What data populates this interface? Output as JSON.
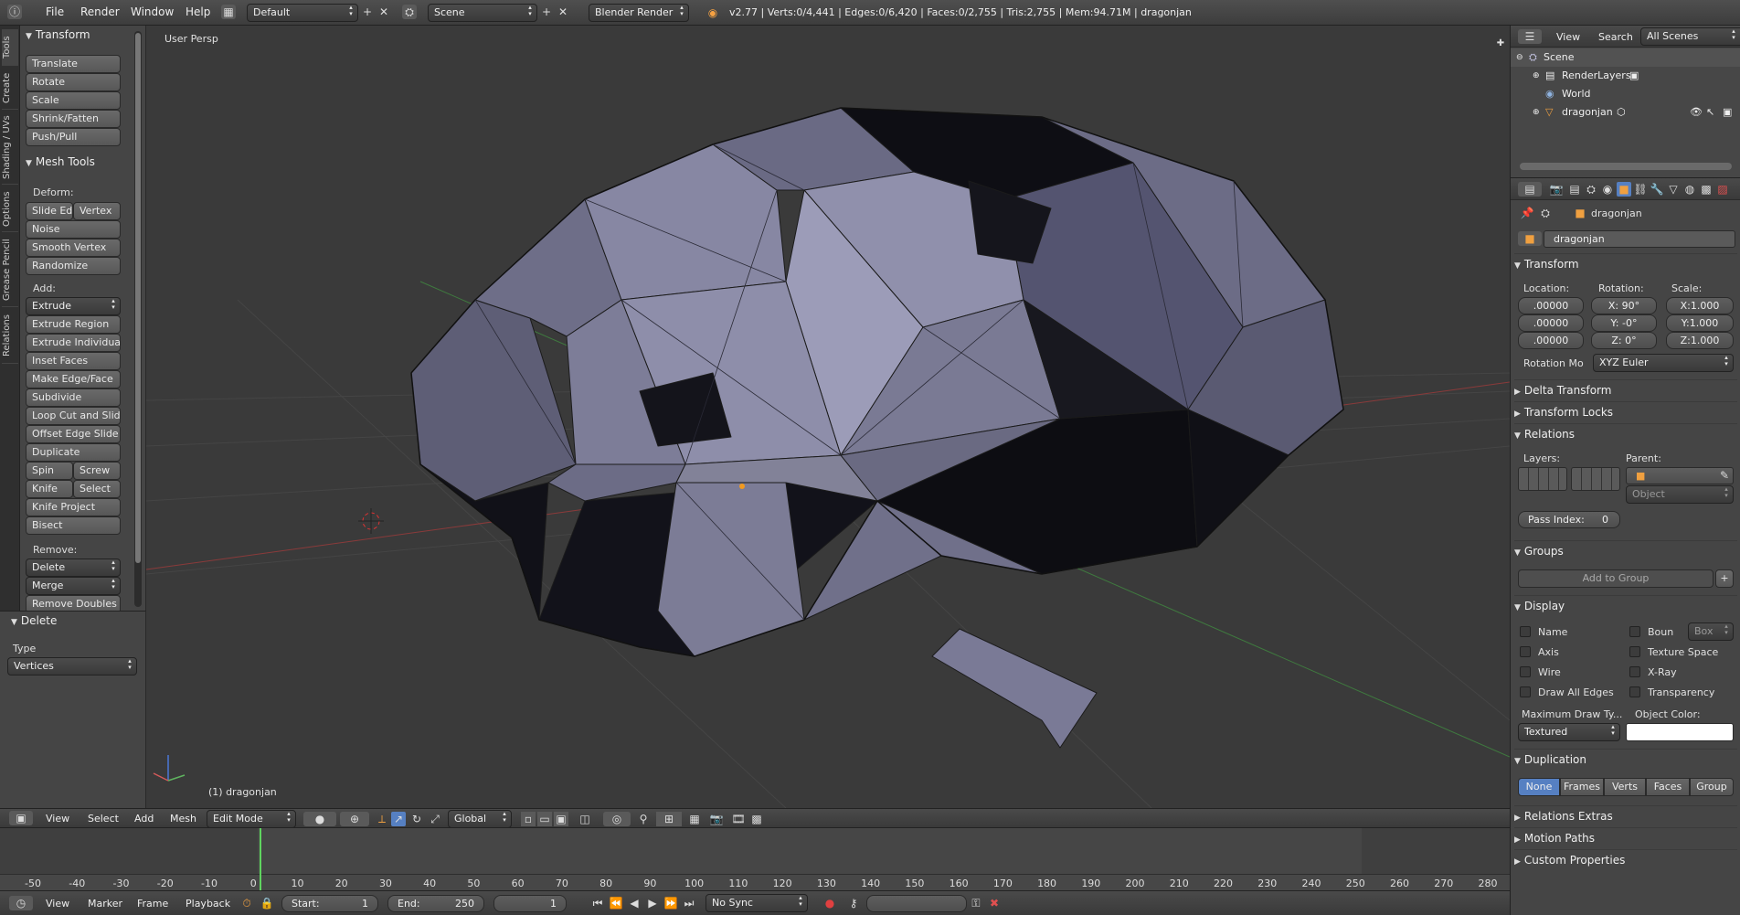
{
  "topbar": {
    "menus": [
      "File",
      "Render",
      "Window",
      "Help"
    ],
    "layout": "Default",
    "scene": "Scene",
    "engine": "Blender Render",
    "stats": "v2.77 | Verts:0/4,441 | Edges:0/6,420 | Faces:0/2,755 | Tris:2,755 | Mem:94.71M | dragonjan"
  },
  "shelf_tabs": [
    "Tools",
    "Create",
    "Shading / UVs",
    "Options",
    "Grease Pencil",
    "Relations"
  ],
  "transform_panel": {
    "title": "Transform",
    "buttons": [
      "Translate",
      "Rotate",
      "Scale",
      "Shrink/Fatten",
      "Push/Pull"
    ]
  },
  "mesh_tools": {
    "title": "Mesh Tools",
    "deform_label": "Deform:",
    "slide_edge": "Slide Ed",
    "vertex": "Vertex",
    "noise": "Noise",
    "smooth_vertex": "Smooth Vertex",
    "randomize": "Randomize",
    "add_label": "Add:",
    "extrude": "Extrude",
    "add_buttons": [
      "Extrude Region",
      "Extrude Individual",
      "Inset Faces",
      "Make Edge/Face",
      "Subdivide",
      "Loop Cut and Slide",
      "Offset Edge Slide",
      "Duplicate"
    ],
    "spin": "Spin",
    "screw": "Screw",
    "knife": "Knife",
    "select": "Select",
    "knife_project": "Knife Project",
    "bisect": "Bisect",
    "remove_label": "Remove:",
    "delete": "Delete",
    "merge": "Merge",
    "remove_doubles": "Remove Doubles"
  },
  "operator": {
    "title": "Delete",
    "type_label": "Type",
    "type_value": "Vertices"
  },
  "viewport": {
    "persp_label": "User Persp",
    "object_label": "(1) dragonjan",
    "colors": {
      "mesh": "#8a8aa6",
      "background": "#3a3a3a"
    }
  },
  "view_header": {
    "menus": [
      "View",
      "Select",
      "Add",
      "Mesh"
    ],
    "mode": "Edit Mode",
    "orientation": "Global"
  },
  "timeline": {
    "ticks": [
      -50,
      -40,
      -30,
      -20,
      -10,
      0,
      10,
      20,
      30,
      40,
      50,
      60,
      70,
      80,
      90,
      100,
      110,
      120,
      130,
      140,
      150,
      160,
      170,
      180,
      190,
      200,
      210,
      220,
      230,
      240,
      250,
      260,
      270,
      280
    ]
  },
  "bottombar": {
    "menus": [
      "View",
      "Marker",
      "Frame",
      "Playback"
    ],
    "start_label": "Start:",
    "start_value": "1",
    "end_label": "End:",
    "end_value": "250",
    "current_frame": "1",
    "sync": "No Sync"
  },
  "outliner": {
    "menus": [
      "View",
      "Search"
    ],
    "filter": "All Scenes",
    "rows": [
      "Scene",
      "RenderLayers",
      "World",
      "dragonjan"
    ]
  },
  "properties": {
    "breadcrumb": "dragonjan",
    "object_name": "dragonjan",
    "transform": {
      "title": "Transform",
      "location_label": "Location:",
      "rotation_label": "Rotation:",
      "scale_label": "Scale:",
      "location": [
        ".00000",
        ".00000",
        ".00000"
      ],
      "rotation": [
        "X:  90°",
        "Y:  -0°",
        "Z:   0°"
      ],
      "scale": [
        "X:1.000",
        "Y:1.000",
        "Z:1.000"
      ],
      "rotation_mode_label": "Rotation Mo",
      "rotation_mode": "XYZ Euler"
    },
    "delta_transform": "Delta Transform",
    "transform_locks": "Transform Locks",
    "relations": {
      "title": "Relations",
      "layers_label": "Layers:",
      "parent_label": "Parent:",
      "parent_type": "Object",
      "pass_index_label": "Pass Index:",
      "pass_index": "0"
    },
    "groups": {
      "title": "Groups",
      "add_to_group": "Add to Group"
    },
    "display": {
      "title": "Display",
      "name": "Name",
      "axis": "Axis",
      "wire": "Wire",
      "draw_all_edges": "Draw All Edges",
      "bounds": "Boun",
      "bounds_type": "Box",
      "texture_space": "Texture Space",
      "xray": "X-Ray",
      "transparency": "Transparency",
      "max_draw_label": "Maximum Draw Ty...",
      "max_draw_value": "Textured",
      "object_color_label": "Object Color:"
    },
    "duplication": {
      "title": "Duplication",
      "options": [
        "None",
        "Frames",
        "Verts",
        "Faces",
        "Group"
      ]
    },
    "relations_extras": "Relations Extras",
    "motion_paths": "Motion Paths",
    "custom_properties": "Custom Properties"
  }
}
